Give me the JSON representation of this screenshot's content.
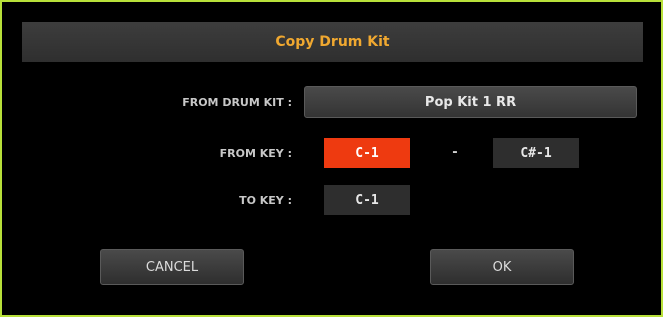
{
  "dialog": {
    "title": "Copy Drum Kit",
    "from_drum_kit_label": "FROM DRUM KIT :",
    "from_drum_kit_value": "Pop Kit 1 RR",
    "from_key_label": "FROM KEY :",
    "from_key_start": "C-1",
    "range_separator": "-",
    "from_key_end": "C#-1",
    "to_key_label": "TO KEY :",
    "to_key_value": "C-1",
    "cancel_label": "CANCEL",
    "ok_label": "OK"
  },
  "colors": {
    "border": "#b8e03a",
    "title_text": "#f0a830",
    "selected_field": "#ee3a10"
  }
}
